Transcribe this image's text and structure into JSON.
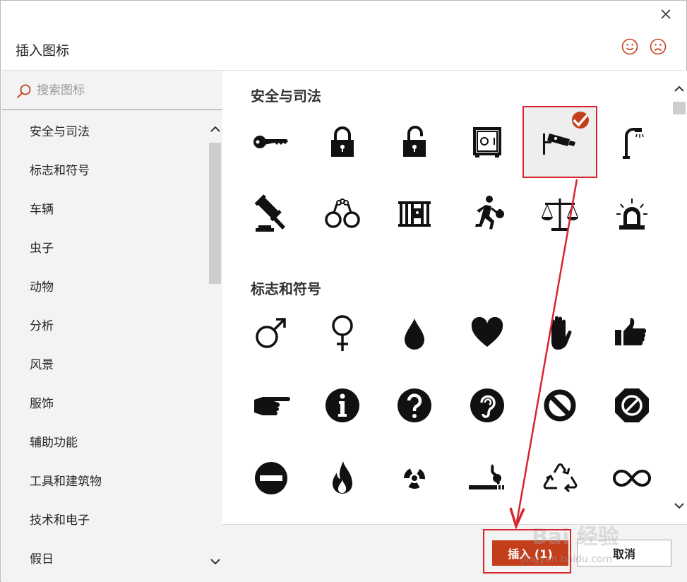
{
  "dialog": {
    "title": "插入图标",
    "close_icon": "close-icon",
    "feedback": [
      "smile-icon",
      "frown-icon"
    ]
  },
  "search": {
    "placeholder": "搜索图标",
    "value": ""
  },
  "categories": [
    {
      "label": "安全与司法"
    },
    {
      "label": "标志和符号"
    },
    {
      "label": "车辆"
    },
    {
      "label": "虫子"
    },
    {
      "label": "动物"
    },
    {
      "label": "分析"
    },
    {
      "label": "风景"
    },
    {
      "label": "服饰"
    },
    {
      "label": "辅助功能"
    },
    {
      "label": "工具和建筑物"
    },
    {
      "label": "技术和电子"
    },
    {
      "label": "假日"
    }
  ],
  "sections": [
    {
      "title": "安全与司法",
      "icons": [
        "key-icon",
        "lock-icon",
        "unlock-icon",
        "safe-icon",
        "security-camera-icon",
        "street-light-icon",
        "gavel-icon",
        "handcuffs-icon",
        "jail-icon",
        "robber-icon",
        "scales-of-justice-icon",
        "siren-icon"
      ]
    },
    {
      "title": "标志和符号",
      "icons": [
        "male-icon",
        "female-icon",
        "drop-icon",
        "heart-icon",
        "hand-stop-icon",
        "thumbs-up-icon",
        "pointing-hand-icon",
        "information-icon",
        "question-icon",
        "hearing-icon",
        "prohibited-icon",
        "no-entry-octagon-icon",
        "do-not-enter-icon",
        "fire-icon",
        "radioactive-icon",
        "smoking-icon",
        "recycle-icon",
        "infinity-icon"
      ]
    }
  ],
  "selected_icon": "security-camera-icon",
  "buttons": {
    "insert_label": "插入 (1)",
    "cancel_label": "取消"
  },
  "colors": {
    "accent": "#c43e1c",
    "annotation": "#d7252b",
    "sidebar_bg": "#f3f3f3"
  },
  "watermark": {
    "text": "Bai 经验",
    "sub": "jingyan.baidu.com"
  }
}
